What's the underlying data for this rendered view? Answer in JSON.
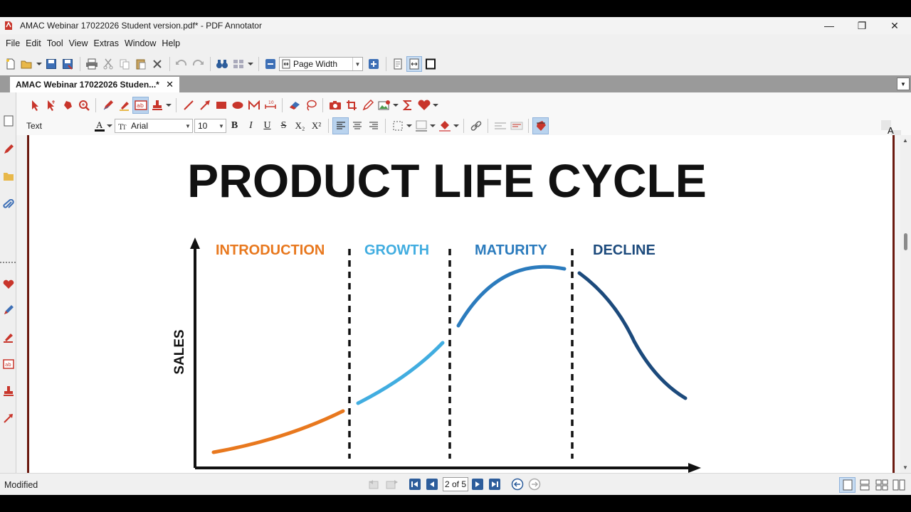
{
  "window": {
    "title": "AMAC Webinar 17022026 Student version.pdf* - PDF Annotator",
    "minimize": "—",
    "restore": "❐",
    "close": "✕"
  },
  "menu": [
    "File",
    "Edit",
    "Tool",
    "View",
    "Extras",
    "Window",
    "Help"
  ],
  "toolbar": {
    "zoom_value": "Page Width"
  },
  "tab": {
    "label": "AMAC Webinar 17022026 Studen...*",
    "close": "✕"
  },
  "annotation_toolbar": {
    "mode_label": "Text",
    "font_name": "Arial",
    "font_size": "10",
    "bold": "B",
    "italic": "I",
    "underline": "U",
    "strike": "S",
    "subscript": "X₂",
    "superscript": "X²",
    "right_tool_letter": "A"
  },
  "document": {
    "heading": "PRODUCT LIFE CYCLE",
    "y_axis_label": "SALES",
    "stages": [
      {
        "name": "INTRODUCTION",
        "color": "#e8781e"
      },
      {
        "name": "GROWTH",
        "color": "#41ade0"
      },
      {
        "name": "MATURITY",
        "color": "#2b7bbd"
      },
      {
        "name": "DECLINE",
        "color": "#1c4a7c"
      }
    ]
  },
  "status": {
    "text": "Modified",
    "page_indicator": "2 of 5"
  },
  "colors": {
    "accent_red": "#c8352b",
    "page_border": "#6b1a10"
  }
}
